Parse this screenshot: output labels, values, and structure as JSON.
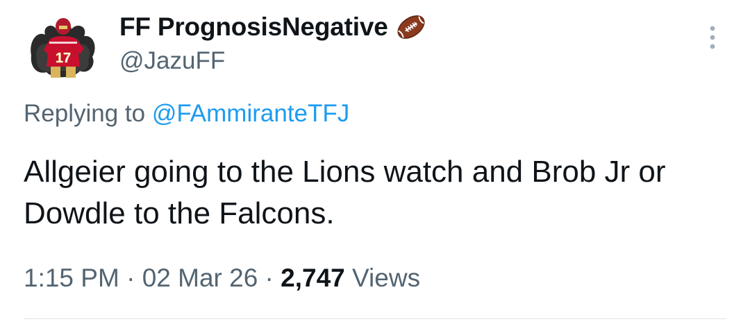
{
  "author": {
    "display_name": "FF PrognosisNegative",
    "handle": "@JazuFF",
    "badge_icon": "american-football-icon",
    "avatar_jersey_number": "17"
  },
  "reply": {
    "prefix": "Replying to ",
    "mention": "@FAmmiranteTFJ"
  },
  "tweet": {
    "text": "Allgeier going to the Lions watch and Brob Jr or Dowdle to the Falcons."
  },
  "meta": {
    "time": "1:15 PM",
    "separator": " · ",
    "date": "02 Mar 26",
    "views_count": "2,747",
    "views_label": " Views"
  },
  "colors": {
    "text_primary": "#0f1419",
    "text_secondary": "#536471",
    "link": "#1d9bf0",
    "divider": "#dfe3e7"
  },
  "icons": {
    "more": "vertical-ellipsis-icon"
  }
}
